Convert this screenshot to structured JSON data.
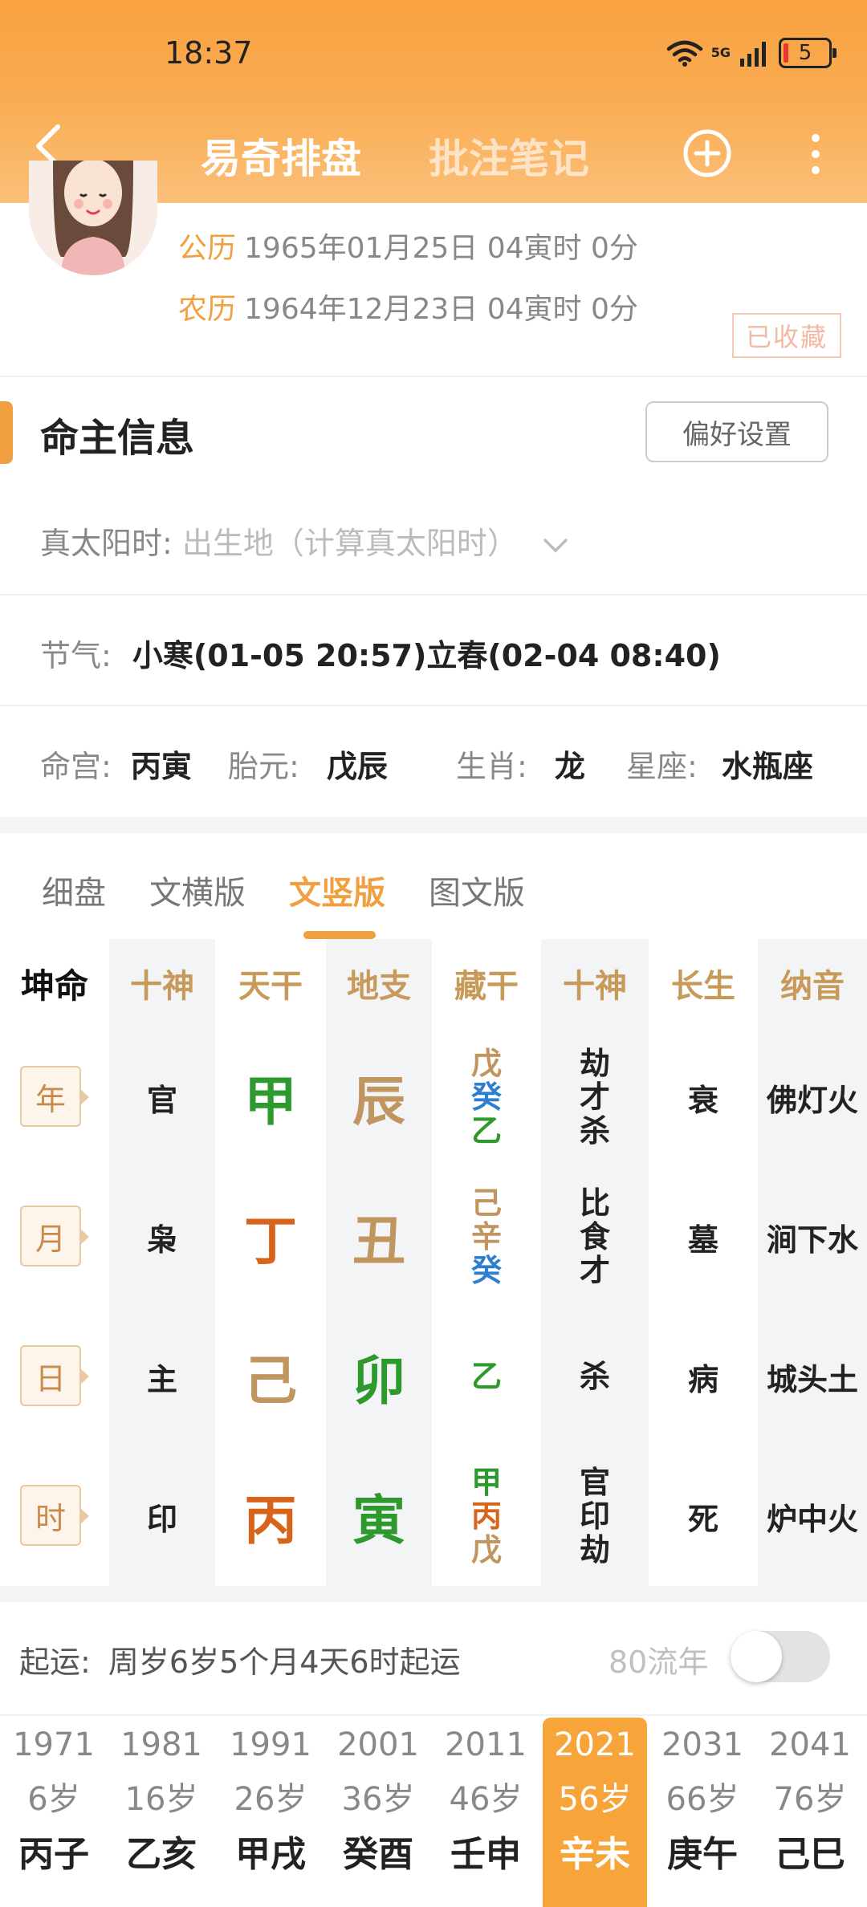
{
  "status_bar": {
    "time": "18:37",
    "network": "5G",
    "battery": "5"
  },
  "nav": {
    "back_icon": "back-arrow-icon",
    "tab_active": "易奇排盘",
    "tab_inactive": "批注笔记",
    "add_icon": "plus-circle-icon",
    "more_icon": "more-vertical-icon"
  },
  "birth": {
    "solar_label": "公历",
    "solar_value": "1965年01月25日 04寅时 0分",
    "lunar_label": "农历",
    "lunar_value": "1964年12月23日 04寅时 0分",
    "stamp": "已收藏"
  },
  "info": {
    "section_title": "命主信息",
    "pref_button": "偏好设置",
    "solar_time_label": "真太阳时:",
    "solar_time_placeholder": "出生地（计算真太阳时）",
    "jieqi_label": "节气:",
    "jieqi_value": "小寒(01-05 20:57)立春(02-04 08:40)",
    "minggong_label": "命宫:",
    "minggong_value": "丙寅",
    "taiyuan_label": "胎元:",
    "taiyuan_value": "戊辰",
    "shengxiao_label": "生肖:",
    "shengxiao_value": "龙",
    "xingzuo_label": "星座:",
    "xingzuo_value": "水瓶座"
  },
  "chart_tabs": [
    "细盘",
    "文横版",
    "文竖版",
    "图文版"
  ],
  "table": {
    "corner": "坤命",
    "headers": [
      "十神",
      "天干",
      "地支",
      "藏干",
      "十神",
      "长生",
      "纳音"
    ],
    "rows": [
      {
        "pillar": "年",
        "god": "官",
        "stem": "甲",
        "branch": "辰",
        "hidden": [
          "戊",
          "癸",
          "乙"
        ],
        "hidden_gods": [
          "劫",
          "才",
          "杀"
        ],
        "stage": "衰",
        "nayin": "佛灯火"
      },
      {
        "pillar": "月",
        "god": "枭",
        "stem": "丁",
        "branch": "丑",
        "hidden": [
          "己",
          "辛",
          "癸"
        ],
        "hidden_gods": [
          "比",
          "食",
          "才"
        ],
        "stage": "墓",
        "nayin": "涧下水"
      },
      {
        "pillar": "日",
        "god": "主",
        "stem": "己",
        "branch": "卯",
        "hidden": [
          "乙"
        ],
        "hidden_gods": [
          "杀"
        ],
        "stage": "病",
        "nayin": "城头土"
      },
      {
        "pillar": "时",
        "god": "印",
        "stem": "丙",
        "branch": "寅",
        "hidden": [
          "甲",
          "丙",
          "戊"
        ],
        "hidden_gods": [
          "官",
          "印",
          "劫"
        ],
        "stage": "死",
        "nayin": "炉中火"
      }
    ]
  },
  "luck": {
    "label": "起运:",
    "value": "周岁6岁5个月4天6时起运",
    "liunian_label": "80流年",
    "toggle_on": false,
    "dayun": [
      {
        "year": "1971",
        "age": "6岁",
        "gz": "丙子"
      },
      {
        "year": "1981",
        "age": "16岁",
        "gz": "乙亥"
      },
      {
        "year": "1991",
        "age": "26岁",
        "gz": "甲戌"
      },
      {
        "year": "2001",
        "age": "36岁",
        "gz": "癸酉"
      },
      {
        "year": "2011",
        "age": "46岁",
        "gz": "壬申"
      },
      {
        "year": "2021",
        "age": "56岁",
        "gz": "辛未"
      },
      {
        "year": "2031",
        "age": "66岁",
        "gz": "庚午"
      },
      {
        "year": "2041",
        "age": "76岁",
        "gz": "己巳"
      }
    ]
  },
  "colors": {
    "accent": "#f0a040",
    "wood": "#2e9a2e",
    "earth": "#c19560",
    "fire": "#d8641c",
    "water": "#2f7fd0",
    "metal": "#222222"
  }
}
